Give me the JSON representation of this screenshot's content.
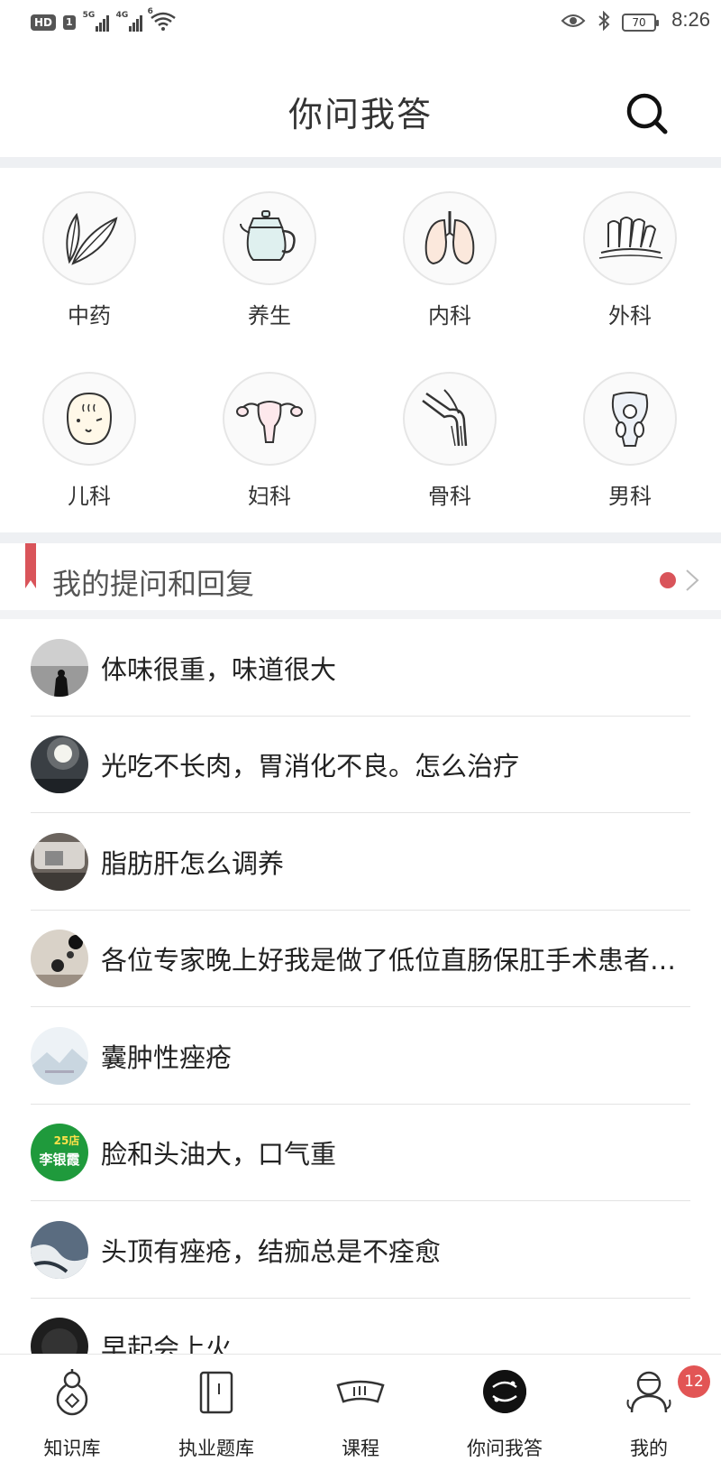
{
  "status_bar": {
    "hd": "HD",
    "sim": "1",
    "net1": "5G",
    "net2": "4G",
    "wifi": "6",
    "battery": "70",
    "time": "8:26"
  },
  "header": {
    "title": "你问我答"
  },
  "categories": [
    {
      "label": "中药",
      "icon": "leaf-icon"
    },
    {
      "label": "养生",
      "icon": "teapot-icon"
    },
    {
      "label": "内科",
      "icon": "lungs-icon"
    },
    {
      "label": "外科",
      "icon": "fingers-icon"
    },
    {
      "label": "儿科",
      "icon": "baby-face-icon"
    },
    {
      "label": "妇科",
      "icon": "uterus-icon"
    },
    {
      "label": "骨科",
      "icon": "knee-bone-icon"
    },
    {
      "label": "男科",
      "icon": "pelvis-icon"
    }
  ],
  "section": {
    "title": "我的提问和回复"
  },
  "questions": [
    {
      "text": "体味很重，味道很大"
    },
    {
      "text": "光吃不长肉，胃消化不良。怎么治疗"
    },
    {
      "text": "脂肪肝怎么调养"
    },
    {
      "text": "各位专家晚上好我是做了低位直肠保肛手术患者，请问"
    },
    {
      "text": "囊肿性痤疮"
    },
    {
      "text": "脸和头油大，口气重",
      "avatar_text_top": "25店",
      "avatar_text_name": "李银霞"
    },
    {
      "text": "头顶有痤疮，结痂总是不痊愈"
    },
    {
      "text": "早起会上火"
    }
  ],
  "tabbar": {
    "tabs": [
      {
        "label": "知识库",
        "icon": "gourd-icon"
      },
      {
        "label": "执业题库",
        "icon": "book-icon"
      },
      {
        "label": "课程",
        "icon": "scroll-icon"
      },
      {
        "label": "你问我答",
        "icon": "yin-yang-icon",
        "active": true
      },
      {
        "label": "我的",
        "icon": "profile-icon"
      }
    ],
    "badge": "12"
  },
  "colors": {
    "accent_red": "#d9545a",
    "badge_red": "#e25555",
    "band_gray": "#eef0f3"
  }
}
